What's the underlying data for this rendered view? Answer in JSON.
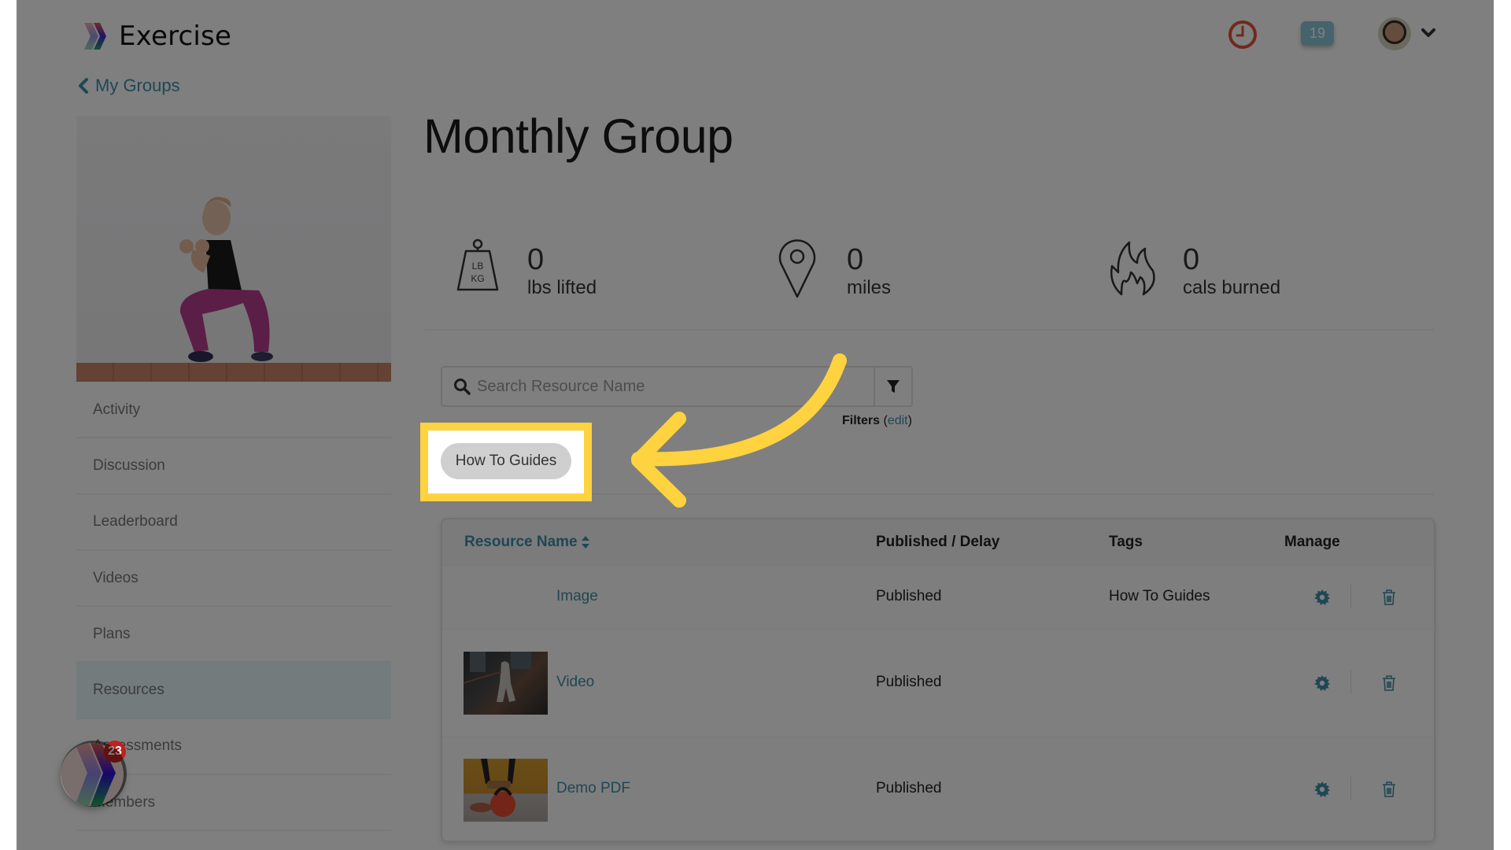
{
  "app": {
    "name": "Exercise",
    "notification_count": "19",
    "help_badge_count": "23"
  },
  "icons": {
    "logo": "exercise-logo-icon",
    "clock": "clock-icon",
    "avatar": "user-avatar",
    "caret": "chevron-down-icon",
    "back": "chevron-left-icon",
    "weight": "weight-icon",
    "location": "map-pin-icon",
    "fire": "flame-icon",
    "search": "search-icon",
    "filter": "filter-icon",
    "sort": "sort-icon",
    "settings": "gear-icon",
    "delete": "trash-icon"
  },
  "nav": {
    "back_label": "My Groups"
  },
  "sidebar": {
    "items": [
      {
        "label": "Activity",
        "active": false
      },
      {
        "label": "Discussion",
        "active": false
      },
      {
        "label": "Leaderboard",
        "active": false
      },
      {
        "label": "Videos",
        "active": false
      },
      {
        "label": "Plans",
        "active": false
      },
      {
        "label": "Resources",
        "active": true
      },
      {
        "label": "Assessments",
        "active": false
      },
      {
        "label": "Members",
        "active": false
      }
    ]
  },
  "page": {
    "title": "Monthly Group"
  },
  "stats": [
    {
      "value": "0",
      "label": "lbs lifted",
      "icon_text_top": "LB",
      "icon_text_bottom": "KG"
    },
    {
      "value": "0",
      "label": "miles"
    },
    {
      "value": "0",
      "label": "cals burned"
    }
  ],
  "search": {
    "placeholder": "Search Resource Name",
    "value": "",
    "filters_label": "Filters",
    "filters_edit": "edit"
  },
  "active_tags": [
    "How To Guides"
  ],
  "table": {
    "columns": [
      "Resource Name",
      "Published / Delay",
      "Tags",
      "Manage"
    ],
    "rows": [
      {
        "name": "Image",
        "status": "Published",
        "tags": "How To Guides",
        "has_thumb": false
      },
      {
        "name": "Video",
        "status": "Published",
        "tags": "",
        "has_thumb": true
      },
      {
        "name": "Demo PDF",
        "status": "Published",
        "tags": "",
        "has_thumb": true
      }
    ]
  },
  "annotation": {
    "highlight_color": "#ffd23f",
    "arrow_color": "#ffd23f"
  },
  "colors": {
    "accent": "#3e8ea8",
    "badge": "#8dc6d6",
    "clock": "#e0523b",
    "active_nav_bg": "#e6f6f9",
    "help_badge": "#c0201f"
  }
}
